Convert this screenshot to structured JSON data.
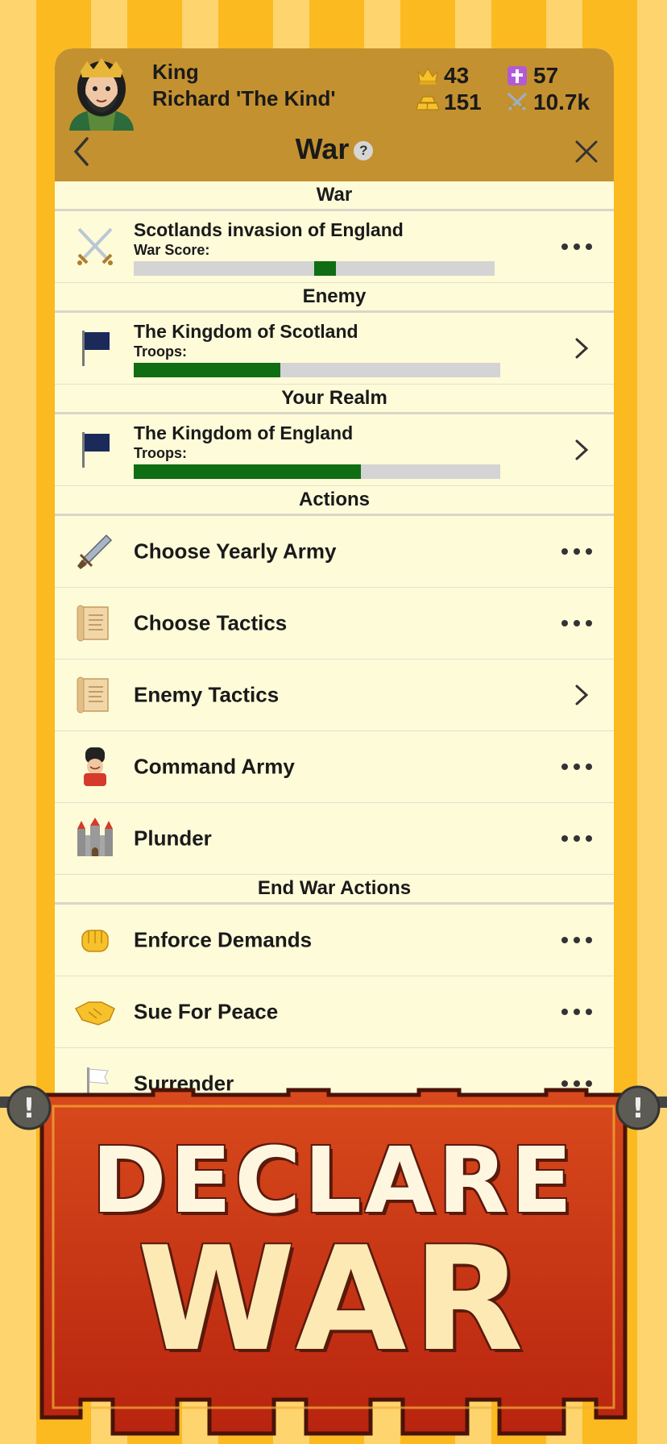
{
  "header": {
    "rank": "King",
    "name": "Richard 'The Kind'",
    "stats": [
      {
        "icon": "crown-icon",
        "value": "43"
      },
      {
        "icon": "cross-icon",
        "value": "57"
      },
      {
        "icon": "gold-bars-icon",
        "value": "151"
      },
      {
        "icon": "swords-icon",
        "value": "10.7k"
      }
    ],
    "title": "War",
    "help": "?"
  },
  "sections": {
    "war": "War",
    "enemy": "Enemy",
    "realm": "Your Realm",
    "actions": "Actions",
    "end_war": "End War Actions"
  },
  "war": {
    "name": "Scotlands invasion of England",
    "score_label": "War Score:",
    "score": 0.06
  },
  "enemy": {
    "name": "The Kingdom of Scotland",
    "troops_label": "Troops:",
    "troops": 0.4
  },
  "realm": {
    "name": "The Kingdom of England",
    "troops_label": "Troops:",
    "troops": 0.62
  },
  "actions": [
    {
      "label": "Choose Yearly Army",
      "icon": "dagger-icon",
      "control": "more"
    },
    {
      "label": "Choose Tactics",
      "icon": "scroll-icon",
      "control": "more"
    },
    {
      "label": "Enemy Tactics",
      "icon": "scroll-icon",
      "control": "chevron"
    },
    {
      "label": "Command Army",
      "icon": "guard-icon",
      "control": "more"
    },
    {
      "label": "Plunder",
      "icon": "castle-icon",
      "control": "more"
    }
  ],
  "end_actions": [
    {
      "label": "Enforce Demands",
      "icon": "fist-icon",
      "control": "more"
    },
    {
      "label": "Sue For Peace",
      "icon": "handshake-icon",
      "control": "more"
    },
    {
      "label": "Surrender",
      "icon": "white-flag-icon",
      "control": "more"
    }
  ],
  "banner": {
    "line1": "DECLARE",
    "line2": "WAR"
  },
  "colors": {
    "header": "#c49130",
    "panel": "#fefbd9",
    "bar_fill": "#0f6d13",
    "banner": "#c8351a"
  }
}
